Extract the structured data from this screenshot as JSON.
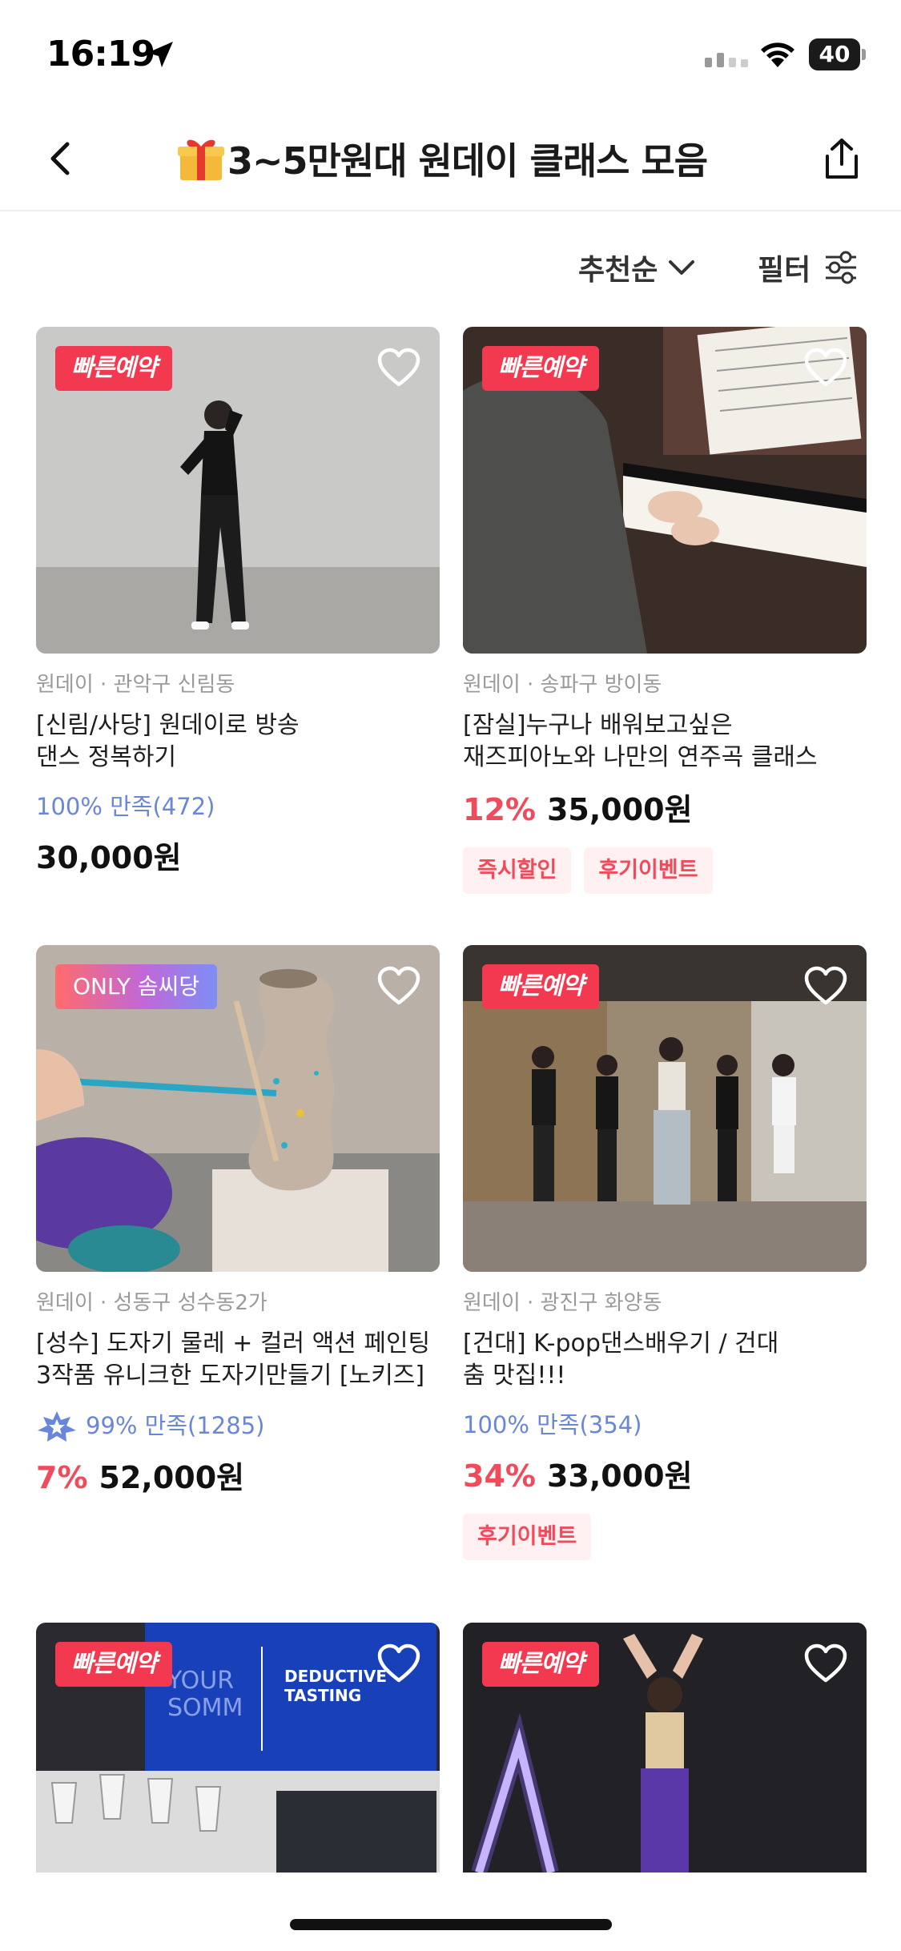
{
  "status_bar": {
    "time": "16:19",
    "battery": "40"
  },
  "header": {
    "title": "3~5만원대 원데이 클래스 모음"
  },
  "toolbar": {
    "sort_label": "추천순",
    "filter_label": "필터"
  },
  "cards": [
    {
      "badge": "빠른예약",
      "location": "원데이 · 관악구 신림동",
      "title_lines": [
        "[신림/사당] 원데이로 방송",
        "댄스 정복하기"
      ],
      "rating": "100% 만족(472)",
      "price": "30,000원"
    },
    {
      "badge": "빠른예약",
      "location": "원데이 · 송파구 방이동",
      "title_lines": [
        "[잠실]누구나 배워보고싶은",
        "재즈피아노와 나만의 연주곡 클래스"
      ],
      "discount": "12%",
      "price": "35,000원",
      "tags": [
        "즉시할인",
        "후기이벤트"
      ]
    },
    {
      "badge": "ONLY 솜씨당",
      "location": "원데이 · 성동구 성수동2가",
      "title_lines": [
        "[성수] 도자기 물레 + 컬러 액션 페인팅",
        "3작품 유니크한 도자기만들기 [노키즈]"
      ],
      "rating": "99% 만족(1285)",
      "discount": "7%",
      "price": "52,000원"
    },
    {
      "badge": "빠른예약",
      "location": "원데이 · 광진구 화양동",
      "title_lines": [
        "[건대] K-pop댄스배우기 / 건대",
        "춤 맛집!!!"
      ],
      "rating": "100% 만족(354)",
      "discount": "34%",
      "price": "33,000원",
      "tags": [
        "후기이벤트"
      ]
    },
    {
      "badge": "빠른예약",
      "screen_text": {
        "left": "YOUR SOMM",
        "right": "DEDUCTIVE TASTING"
      }
    },
    {
      "badge": "빠른예약"
    }
  ],
  "colors": {
    "accent_red": "#f2394f",
    "discount_red": "#ef4b5a",
    "rating_blue": "#6a86d8"
  }
}
